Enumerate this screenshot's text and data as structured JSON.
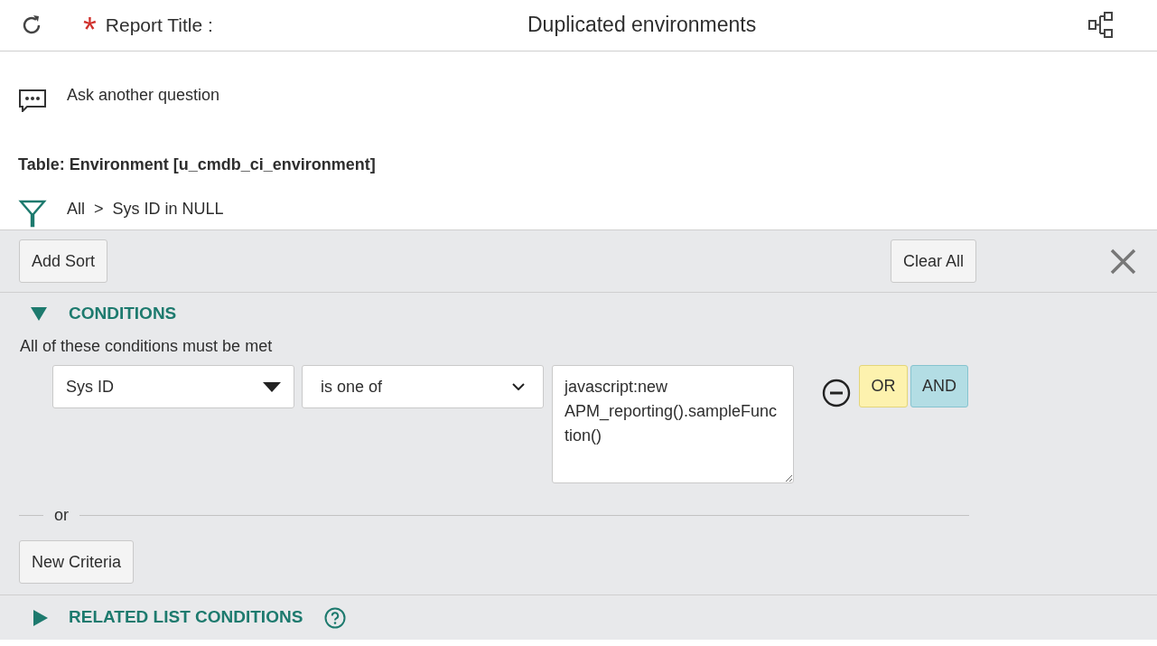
{
  "header": {
    "required_mark": "*",
    "label": "Report Title :",
    "title": "Duplicated environments"
  },
  "ask": {
    "label": "Ask another question"
  },
  "table": {
    "label": "Table: Environment [u_cmdb_ci_environment]"
  },
  "breadcrumb": {
    "items": [
      "All",
      ">",
      "Sys ID in NULL"
    ]
  },
  "toolbar": {
    "add_sort": "Add Sort",
    "clear_all": "Clear All"
  },
  "conditions": {
    "title": "CONDITIONS",
    "expanded": true,
    "hint": "All of these conditions must be met",
    "rows": [
      {
        "field": "Sys ID",
        "operator": "is one of",
        "value": "javascript:new APM_reporting().sampleFunction()",
        "or": "OR",
        "and": "AND"
      }
    ],
    "separator": "or",
    "new_criteria": "New Criteria"
  },
  "related": {
    "title": "RELATED LIST CONDITIONS",
    "expanded": false
  }
}
